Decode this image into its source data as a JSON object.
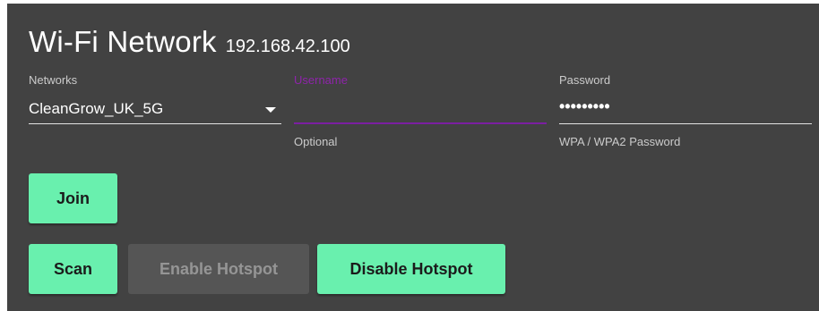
{
  "header": {
    "title": "Wi-Fi Network",
    "ip_address": "192.168.42.100"
  },
  "form": {
    "networks": {
      "label": "Networks",
      "selected": "CleanGrow_UK_5G"
    },
    "username": {
      "label": "Username",
      "value": "",
      "hint": "Optional"
    },
    "password": {
      "label": "Password",
      "masked_value": "•••••••••",
      "hint": "WPA / WPA2 Password"
    }
  },
  "buttons": {
    "join": "Join",
    "scan": "Scan",
    "enable_hotspot": "Enable Hotspot",
    "disable_hotspot": "Disable Hotspot"
  },
  "colors": {
    "panel_background": "#424242",
    "accent_button": "#69f0ae",
    "focus_purple": "#7b1fa2",
    "disabled_button": "#555555"
  }
}
